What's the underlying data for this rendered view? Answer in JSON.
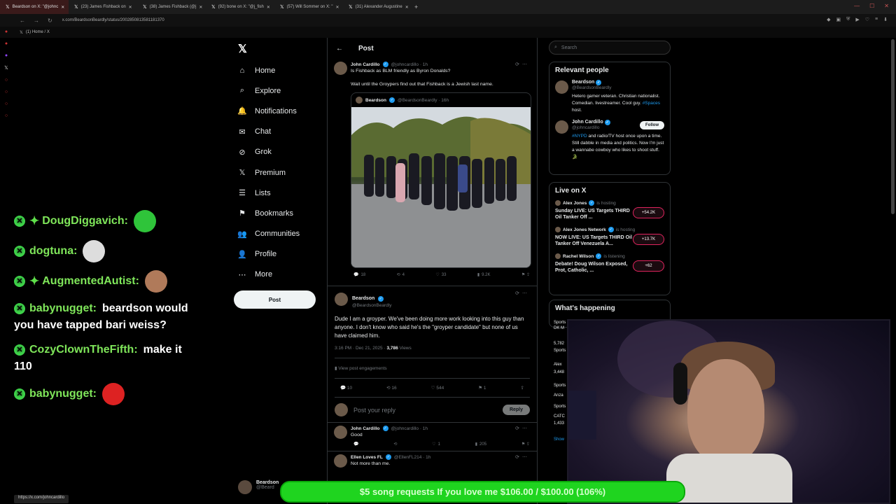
{
  "browser": {
    "tabs": [
      {
        "label": "Beardson on X: \"@johnc",
        "active": true
      },
      {
        "label": "(23) James Fishback on",
        "active": false
      },
      {
        "label": "(38) James Fishback (@j",
        "active": false
      },
      {
        "label": "(92) bone on X: \"@j_fish",
        "active": false
      },
      {
        "label": "(57) Will Sommer on X: \"",
        "active": false
      },
      {
        "label": "(31) Alexander Augustine",
        "active": false
      }
    ],
    "url": "x.com/BeardsonBeardly/status/2002850813581181370",
    "bookmark": "(1) Home / X",
    "status_url": "https://x.com/johncardillo"
  },
  "chat": {
    "messages": [
      {
        "user": "DougDiggavich:",
        "text": "",
        "star": true,
        "emote": "green-laugh"
      },
      {
        "user": "dogtuna:",
        "text": "",
        "star": false,
        "emote": "cat"
      },
      {
        "user": "AugmentedAutist:",
        "text": "",
        "star": true,
        "emote": "face"
      },
      {
        "user": "babynugget:",
        "text": "beardson would you have tapped bari weiss?",
        "star": false,
        "emote": ""
      },
      {
        "user": "CozyClownTheFifth:",
        "text": "make it 110",
        "star": false,
        "emote": ""
      },
      {
        "user": "babynugget:",
        "text": "",
        "star": false,
        "emote": "santa"
      }
    ]
  },
  "nav": {
    "items": [
      {
        "label": "Home",
        "icon": "home-icon",
        "glyph": "⌂"
      },
      {
        "label": "Explore",
        "icon": "search-icon",
        "glyph": "⌕"
      },
      {
        "label": "Notifications",
        "icon": "bell-icon",
        "glyph": "🔔"
      },
      {
        "label": "Chat",
        "icon": "mail-icon",
        "glyph": "✉"
      },
      {
        "label": "Grok",
        "icon": "grok-icon",
        "glyph": "⊘"
      },
      {
        "label": "Premium",
        "icon": "x-logo-icon",
        "glyph": "𝕏"
      },
      {
        "label": "Lists",
        "icon": "list-icon",
        "glyph": "☰"
      },
      {
        "label": "Bookmarks",
        "icon": "bookmark-icon",
        "glyph": "⚑"
      },
      {
        "label": "Communities",
        "icon": "people-icon",
        "glyph": "👥"
      },
      {
        "label": "Profile",
        "icon": "person-icon",
        "glyph": "👤"
      },
      {
        "label": "More",
        "icon": "more-icon",
        "glyph": "⋯"
      }
    ],
    "post_label": "Post",
    "account_name": "Beardson",
    "account_handle": "@Beard"
  },
  "main": {
    "header": "Post",
    "parent": {
      "name": "John Cardillo",
      "handle": "@johncardillo · 1h",
      "text1": "Is Fishback as BLM friendly as Byron Donalds?",
      "text2": "Wait until the Groypers find out that Fishback is a Jewish last name.",
      "quote_name": "Beardson",
      "quote_handle": "@BeardsonBeardly · 16h",
      "actions": {
        "replies": "18",
        "reposts": "4",
        "likes": "33",
        "views": "9.2K"
      }
    },
    "focal": {
      "name": "Beardson",
      "handle": "@BeardsonBeardly",
      "text": "Dude I am a groyper. We've been doing more work looking into this guy than anyone. I don't know who said he's the \"groyper candidate\" but none of us have claimed him.",
      "time": "3:16 PM · Dec 21, 2025 ·",
      "views": "3,786",
      "views_label": "Views",
      "engagements": "View post engagements",
      "actions": {
        "replies": "10",
        "reposts": "16",
        "likes": "544",
        "bookmarks": "1"
      }
    },
    "reply_box": {
      "placeholder": "Post your reply",
      "button": "Reply"
    },
    "replies": [
      {
        "name": "John Cardillo",
        "handle": "@johncardillo · 1h",
        "text": "Good",
        "likes": "1",
        "views": "205"
      },
      {
        "name": "Ellen Loves FL",
        "handle": "@EllenFL214 · 1h",
        "text": "Not more than me."
      }
    ]
  },
  "right": {
    "search_placeholder": "Search",
    "relevant_title": "Relevant people",
    "people": [
      {
        "name": "Beardson",
        "handle": "@BeardsonBeardly",
        "bio": "Hetero gamer veteran. Christian nationalist. Comedian. livestreamer. Cool guy.",
        "bio_link": "#Spaces",
        "bio_end": "host.",
        "follow": ""
      },
      {
        "name": "John Cardillo",
        "handle": "@johncardillo",
        "bio_link": "#NYPD",
        "bio": "and radio/TV host once upon a time. Still dabble in media and politics. Now I'm just a wannabe cowboy who likes to shoot stuff. 🐊",
        "follow": "Follow"
      }
    ],
    "live_title": "Live on X",
    "live": [
      {
        "host": "Alex Jones",
        "status": "is hosting",
        "title": "Sunday LIVE: US Targets THIRD Oil Tanker Off ...",
        "count": "+54.2K"
      },
      {
        "host": "Alex Jones Network",
        "status": "is hosting",
        "title": "NOW LIVE: US Targets THIRD Oil Tanker Off Venezuela A...",
        "count": "+13.7K"
      },
      {
        "host": "Rachel Wilson",
        "status": "is listening",
        "title": "Debate! Doug Wilson Exposed, Prot, Catholic, ...",
        "count": "+62"
      }
    ],
    "happening_title": "What's happening",
    "happening_peek": [
      "Sports",
      "DK M",
      "5,782",
      "Sports",
      "Alex",
      "3,448",
      "Sports",
      "Anza",
      "Sports",
      "CATC",
      "1,433",
      "Show"
    ]
  },
  "donation": {
    "text": "$5 song requests If you love me $106.00 / $100.00 (106%)",
    "progress": 1.0
  }
}
